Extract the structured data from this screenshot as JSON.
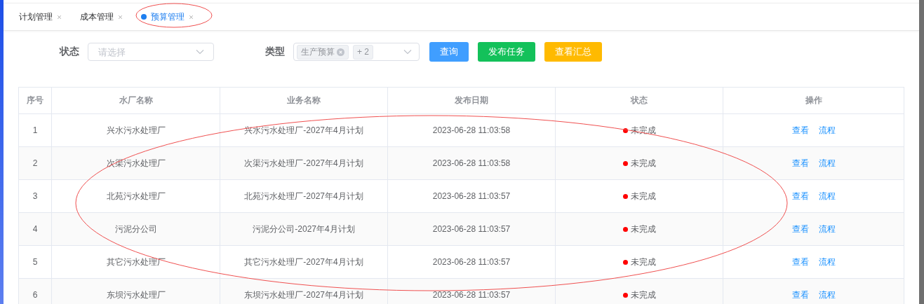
{
  "tabs": [
    {
      "label": "计划管理",
      "selected": false
    },
    {
      "label": "成本管理",
      "selected": false
    },
    {
      "label": "预算管理",
      "selected": true
    }
  ],
  "filters": {
    "status": {
      "label": "状态",
      "placeholder": "请选择"
    },
    "type": {
      "label": "类型",
      "tags": [
        "生产预算"
      ],
      "more": "+ 2"
    }
  },
  "buttons": [
    {
      "label": "查询",
      "kind": "primary"
    },
    {
      "label": "发布任务",
      "kind": "success"
    },
    {
      "label": "查看汇总",
      "kind": "warning"
    }
  ],
  "table": {
    "columns": [
      "序号",
      "水厂名称",
      "业务名称",
      "发布日期",
      "状态",
      "操作"
    ],
    "rows": [
      {
        "index": "1",
        "plant": "兴水污水处理厂",
        "business": "兴水污水处理厂-2027年4月计划",
        "date": "2023-06-28 11:03:58",
        "status": {
          "text": "未完成",
          "kind": "incomplete"
        },
        "actions": [
          "查看",
          "流程"
        ]
      },
      {
        "index": "2",
        "plant": "次渠污水处理厂",
        "business": "次渠污水处理厂-2027年4月计划",
        "date": "2023-06-28 11:03:58",
        "status": {
          "text": "未完成",
          "kind": "incomplete"
        },
        "actions": [
          "查看",
          "流程"
        ]
      },
      {
        "index": "3",
        "plant": "北苑污水处理厂",
        "business": "北苑污水处理厂-2027年4月计划",
        "date": "2023-06-28 11:03:57",
        "status": {
          "text": "未完成",
          "kind": "incomplete"
        },
        "actions": [
          "查看",
          "流程"
        ]
      },
      {
        "index": "4",
        "plant": "污泥分公司",
        "business": "污泥分公司-2027年4月计划",
        "date": "2023-06-28 11:03:57",
        "status": {
          "text": "未完成",
          "kind": "incomplete"
        },
        "actions": [
          "查看",
          "流程"
        ]
      },
      {
        "index": "5",
        "plant": "其它污水处理厂",
        "business": "其它污水处理厂-2027年4月计划",
        "date": "2023-06-28 11:03:57",
        "status": {
          "text": "未完成",
          "kind": "incomplete"
        },
        "actions": [
          "查看",
          "流程"
        ]
      },
      {
        "index": "6",
        "plant": "东坝污水处理厂",
        "business": "东坝污水处理厂-2027年4月计划",
        "date": "2023-06-28 11:03:57",
        "status": {
          "text": "未完成",
          "kind": "incomplete"
        },
        "actions": [
          "查看",
          "流程"
        ]
      }
    ]
  },
  "annotations": [
    {
      "kind": "ellipse"
    },
    {
      "kind": "ellipse"
    }
  ]
}
